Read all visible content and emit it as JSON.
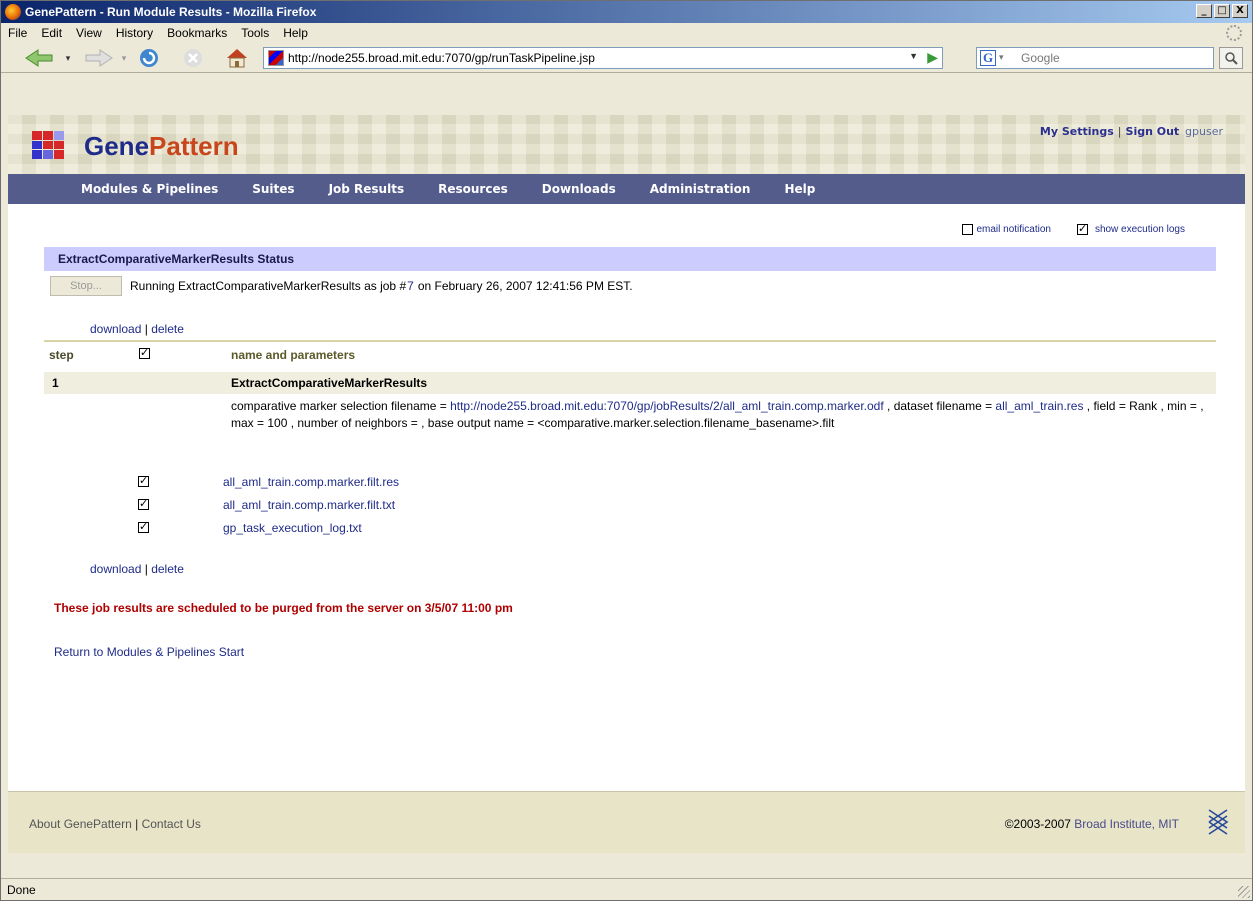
{
  "window": {
    "title": "GenePattern - Run Module Results - Mozilla Firefox",
    "buttons": {
      "minimize": "_",
      "maximize": "□",
      "close": "X"
    }
  },
  "menu": {
    "items": [
      "File",
      "Edit",
      "View",
      "History",
      "Bookmarks",
      "Tools",
      "Help"
    ]
  },
  "navbar": {
    "url": "http://node255.broad.mit.edu:7070/gp/runTaskPipeline.jsp",
    "search_placeholder": "Google"
  },
  "gp": {
    "brand_part1": "Gene",
    "brand_part2": "Pattern",
    "user_links": {
      "settings": "My Settings",
      "separator": "|",
      "signout": "Sign Out",
      "user": "gpuser"
    },
    "nav": [
      "Modules & Pipelines",
      "Suites",
      "Job Results",
      "Resources",
      "Downloads",
      "Administration",
      "Help"
    ]
  },
  "job": {
    "email_notification": {
      "label": "email notification",
      "checked": false
    },
    "show_logs": {
      "label": "show execution logs",
      "checked": true
    },
    "status_title": "ExtractComparativeMarkerResults Status",
    "stop_label": "Stop...",
    "run_prefix": "Running ExtractComparativeMarkerResults as job #",
    "job_number": "7",
    "run_suffix": "on February 26, 2007 12:41:56 PM EST.",
    "download": "download",
    "link_sep": "|",
    "delete": "delete",
    "table": {
      "col_step": "step",
      "col_name": "name and parameters",
      "step": "1",
      "module": "ExtractComparativeMarkerResults",
      "params": {
        "p1": "comparative marker selection filename = ",
        "p1_link": "http://node255.broad.mit.edu:7070/gp/jobResults/2/all_aml_train.comp.marker.odf",
        "p2": " , dataset filename = ",
        "p2_link": "all_aml_train.res",
        "p3": " , field = Rank , min = , max = 100 , number of neighbors = , base output name = <comparative.marker.selection.filename_basename>.filt"
      },
      "files": [
        "all_aml_train.comp.marker.filt.res",
        "all_aml_train.comp.marker.filt.txt",
        "gp_task_execution_log.txt"
      ]
    },
    "purge_notice": "These job results are scheduled to be purged from the server on 3/5/07 11:00 pm",
    "return_link": "Return to Modules & Pipelines Start"
  },
  "footer": {
    "about": "About GenePattern",
    "separator": "|",
    "contact": "Contact Us",
    "copyright": "©2003-2007",
    "institute": "Broad Institute, MIT"
  },
  "status": {
    "text": "Done"
  },
  "colors": {
    "nav_bg": "#545c8c",
    "status_band": "#ccccff",
    "link": "#1f2b88",
    "purge": "#b00000",
    "header_bg": "#e7e4cc"
  }
}
